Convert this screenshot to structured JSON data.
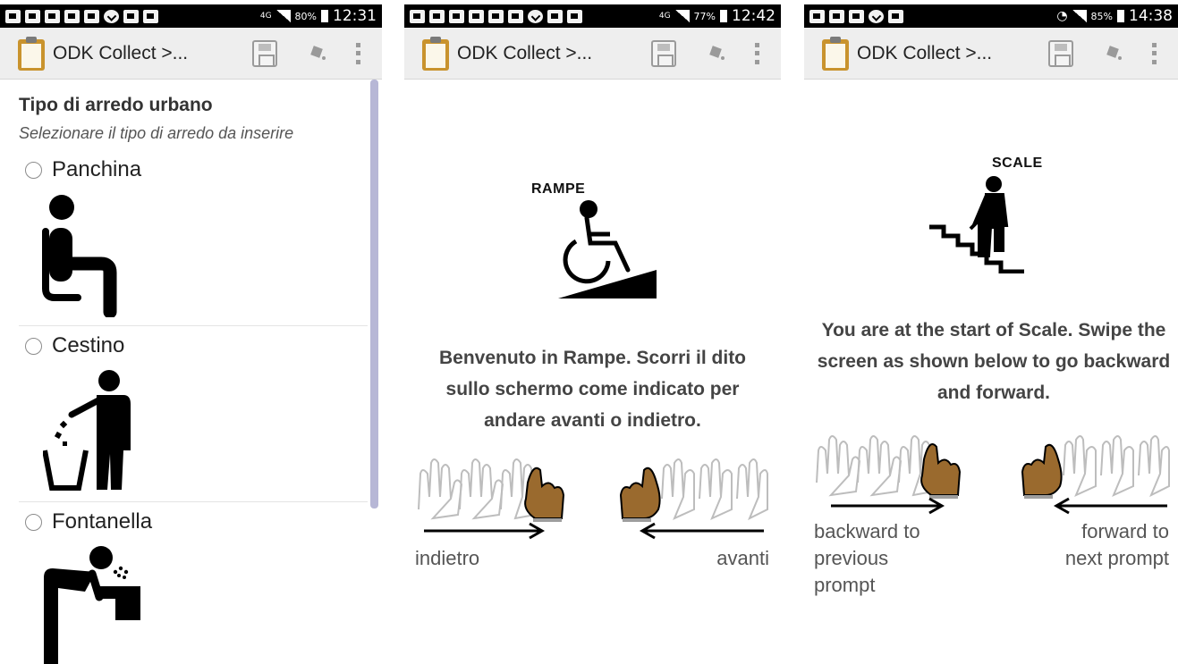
{
  "screens": [
    {
      "status": {
        "network": "4G",
        "battery": "80%",
        "time": "12:31"
      },
      "app_title": "ODK Collect >...",
      "question": "Tipo di arredo urbano",
      "hint": "Selezionare il tipo di arredo da inserire",
      "choices": [
        "Panchina",
        "Cestino",
        "Fontanella"
      ]
    },
    {
      "status": {
        "network": "4G",
        "battery": "77%",
        "time": "12:42"
      },
      "app_title": "ODK Collect >...",
      "sign_label": "RAMPE",
      "message": "Benvenuto in Rampe. Scorri il dito sullo schermo come indicato per andare avanti o indietro.",
      "backward_label": "indietro",
      "forward_label": "avanti"
    },
    {
      "status": {
        "network": "",
        "battery": "85%",
        "time": "14:38"
      },
      "app_title": "ODK Collect >...",
      "sign_label": "SCALE",
      "message": "You are at the start of Scale. Swipe the screen as shown below to go backward and forward.",
      "backward_label": "backward to previous prompt",
      "forward_label": "forward to next prompt"
    }
  ],
  "colors": {
    "statusbar": "#000000",
    "actionbar": "#eeeeee",
    "hand_active": "#9a6a2e",
    "scrollbar": "#b7b7d6"
  },
  "icons": [
    "app-clipboard-icon",
    "save-icon",
    "navigate-icon",
    "overflow-menu-icon"
  ]
}
